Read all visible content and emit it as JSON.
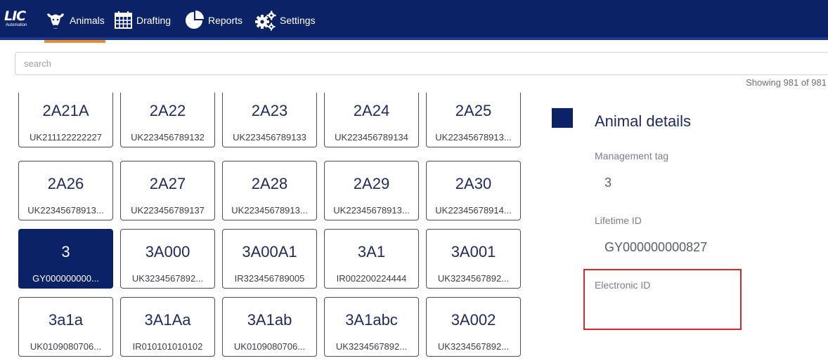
{
  "brand": {
    "logo_text": "LIC",
    "logo_sub": "Automation"
  },
  "nav": [
    {
      "label": "Animals",
      "icon": "cow-icon",
      "active": true
    },
    {
      "label": "Drafting",
      "icon": "calendar-icon",
      "active": false
    },
    {
      "label": "Reports",
      "icon": "pie-chart-icon",
      "active": false
    },
    {
      "label": "Settings",
      "icon": "gears-icon",
      "active": false
    }
  ],
  "search": {
    "placeholder": "search",
    "value": ""
  },
  "result_count": "Showing 981 of 981",
  "animals": [
    {
      "tag": "2A21A",
      "lifetime_id": "UK211122222227"
    },
    {
      "tag": "2A22",
      "lifetime_id": "UK223456789132"
    },
    {
      "tag": "2A23",
      "lifetime_id": "UK223456789133"
    },
    {
      "tag": "2A24",
      "lifetime_id": "UK223456789134"
    },
    {
      "tag": "2A25",
      "lifetime_id": "UK22345678913..."
    },
    {
      "tag": "2A26",
      "lifetime_id": "UK22345678913..."
    },
    {
      "tag": "2A27",
      "lifetime_id": "UK223456789137"
    },
    {
      "tag": "2A28",
      "lifetime_id": "UK22345678913..."
    },
    {
      "tag": "2A29",
      "lifetime_id": "UK22345678913..."
    },
    {
      "tag": "2A30",
      "lifetime_id": "UK22345678914..."
    },
    {
      "tag": "3",
      "lifetime_id": "GY000000000...",
      "selected": true
    },
    {
      "tag": "3A000",
      "lifetime_id": "UK3234567892..."
    },
    {
      "tag": "3A00A1",
      "lifetime_id": "IR323456789005"
    },
    {
      "tag": "3A1",
      "lifetime_id": "IR002200224444"
    },
    {
      "tag": "3A001",
      "lifetime_id": "UK3234567892..."
    },
    {
      "tag": "3a1a",
      "lifetime_id": "UK0109080706..."
    },
    {
      "tag": "3A1Aa",
      "lifetime_id": "IR010101010102"
    },
    {
      "tag": "3A1ab",
      "lifetime_id": "UK0109080706..."
    },
    {
      "tag": "3A1abc",
      "lifetime_id": "UK3234567892..."
    },
    {
      "tag": "3A002",
      "lifetime_id": "UK3234567892..."
    }
  ],
  "details": {
    "title": "Animal details",
    "management_tag_label": "Management tag",
    "management_tag_value": "3",
    "lifetime_id_label": "Lifetime ID",
    "lifetime_id_value": "GY000000000827",
    "electronic_id_label": "Electronic ID",
    "electronic_id_value": ""
  },
  "colors": {
    "navy": "#0b2366",
    "accent": "#f08a24",
    "highlight": "#d9262c"
  }
}
